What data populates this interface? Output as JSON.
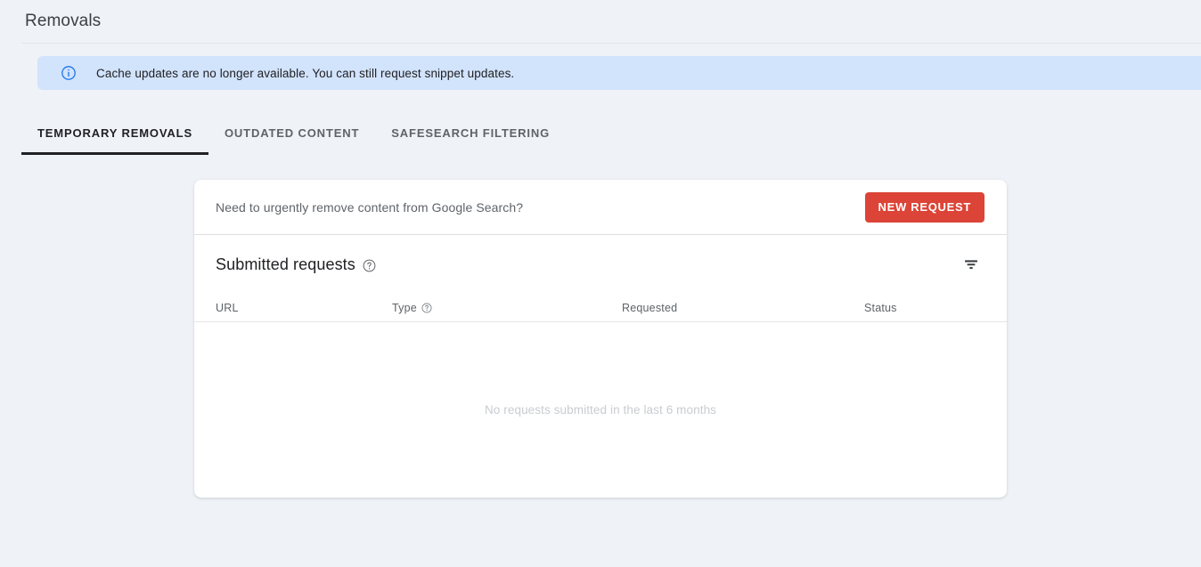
{
  "header": {
    "title": "Removals"
  },
  "banner": {
    "icon": "info-circle-icon",
    "text": "Cache updates are no longer available. You can still request snippet updates.",
    "background_color": "#d2e3fc",
    "icon_color": "#1a73e8"
  },
  "tabs": [
    {
      "label": "TEMPORARY REMOVALS",
      "active": true
    },
    {
      "label": "OUTDATED CONTENT",
      "active": false
    },
    {
      "label": "SAFESEARCH FILTERING",
      "active": false
    }
  ],
  "card": {
    "prompt": "Need to urgently remove content from Google Search?",
    "new_request_label": "NEW REQUEST",
    "new_request_color": "#db4437",
    "section_title": "Submitted requests",
    "section_help_icon": "help-circle-icon",
    "filter_icon": "filter-icon",
    "table": {
      "columns": [
        {
          "label": "URL",
          "help": false
        },
        {
          "label": "Type",
          "help": true
        },
        {
          "label": "Requested",
          "help": false
        },
        {
          "label": "Status",
          "help": false
        }
      ],
      "rows": [],
      "empty_message": "No requests submitted in the last 6 months"
    }
  },
  "page_background": "#eff2f7"
}
